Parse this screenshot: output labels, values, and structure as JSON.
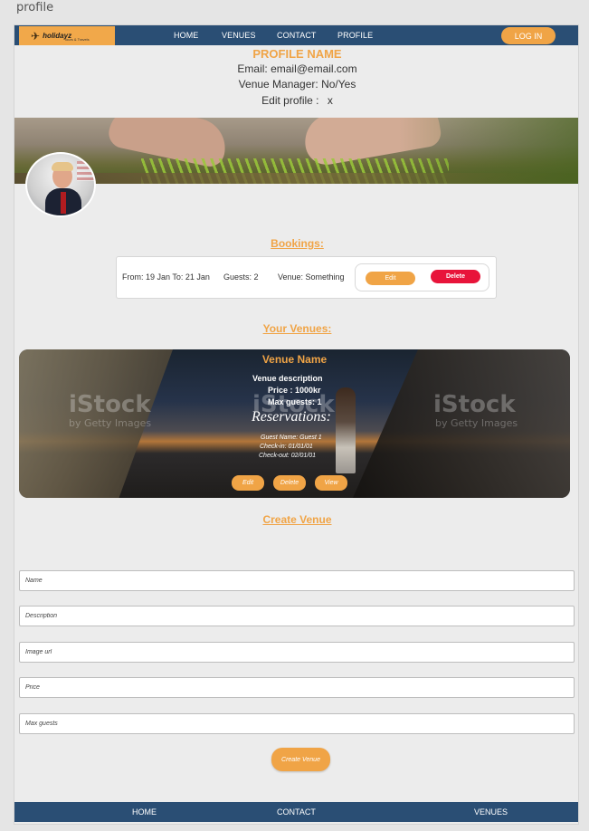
{
  "frame_label": "profile",
  "nav": {
    "logo_mark": "✈",
    "logo_text": "holidayz",
    "logo_sub": "Tours & Travels",
    "links": [
      "HOME",
      "VENUES",
      "CONTACT",
      "PROFILE"
    ],
    "login": "LOG IN"
  },
  "profile": {
    "name": "PROFILE NAME",
    "email_line": "Email: email@email.com",
    "manager_line": "Venue Manager: No/Yes",
    "edit_label": "Edit profile :",
    "edit_x": "x"
  },
  "bookings": {
    "title": "Bookings:",
    "item": {
      "dates": "From: 19 Jan To: 21 Jan",
      "guests": "Guests: 2",
      "venue": "Venue: Something",
      "edit": "Edit",
      "delete": "Delete"
    }
  },
  "venues": {
    "title": "Your Venues:",
    "card": {
      "name": "Venue Name",
      "description": "Venue description",
      "price": "Price : 1000kr",
      "max_guests": "Max guests: 1",
      "reservations_title": "Reservations:",
      "guest_name": "Guest Name: Guest 1",
      "check_in": "Check-in: 01/01/01",
      "check_out": "Check-out: 02/01/01",
      "watermark": "iStock",
      "watermark_sub": "by Getty Images",
      "edit": "Edit",
      "delete": "Delete",
      "view": "View"
    }
  },
  "create_venue": {
    "title": "Create Venue",
    "placeholders": {
      "name": "Name",
      "description": "Description",
      "image_url": "Image url",
      "price": "Price",
      "max_guests": "Max guests"
    },
    "submit": "Create Venue"
  },
  "footer": {
    "links": [
      "HOME",
      "CONTACT",
      "VENUES"
    ]
  },
  "colors": {
    "nav": "#2a4e74",
    "accent": "#f0a446",
    "danger": "#e8143a",
    "page": "#ececec"
  }
}
